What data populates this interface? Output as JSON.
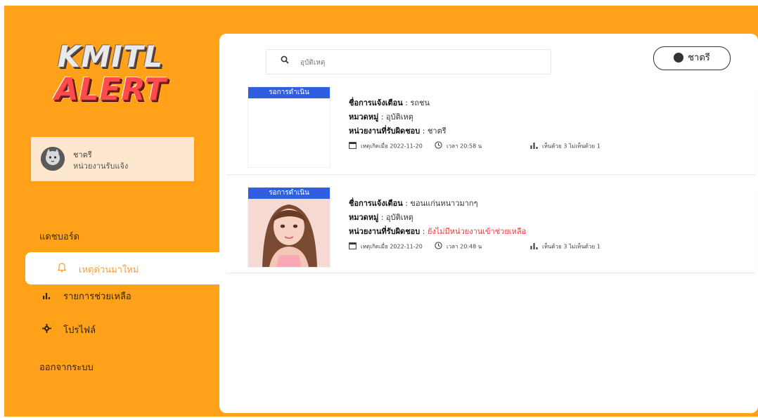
{
  "sidebar": {
    "logo": {
      "line1": "KMITL",
      "line2": "ALERT"
    },
    "user": {
      "name": "ชาตรี",
      "role": "หน่วยงานรับแจ้ง"
    },
    "dashboard_label": "แดชบอร์ด",
    "items": [
      {
        "label": "เหตุด่วนมาใหม่",
        "icon": "bell-icon"
      },
      {
        "label": "รายการช่วยเหลือ",
        "icon": "bar-chart-icon"
      },
      {
        "label": "โปรไฟล์",
        "icon": "gear-icon"
      }
    ],
    "logout_label": "ออกจากระบบ"
  },
  "header": {
    "search_value": "อุบัติเหตุ",
    "profile_label": "ชาตรี"
  },
  "cards": [
    {
      "status": "รอการดำเนิน",
      "title_label": "ชื่อการแจ้งเตือน",
      "title_value": "รถชน",
      "category_label": "หมวดหมู่",
      "category_value": "อุบัติเหตุ",
      "agency_label": "หน่วยงานที่รับผิดชอบ",
      "agency_value": "ชาตรี",
      "date_text": "เหตุเกิดเมื่อ 2022-11-20",
      "time_text": "เวลา 20:58 น",
      "stats_text": "เห็นด้วย 3 ไม่เห็นด้วย 1"
    },
    {
      "status": "รอการดำเนิน",
      "title_label": "ชื่อการแจ้งเตือน",
      "title_value": "ขอนแก่นหนาวมากๆ",
      "category_label": "หมวดหมู่",
      "category_value": "อุบัติเหตุ",
      "agency_label": "หน่วยงานที่รับผิดชอบ",
      "agency_value": "ยังไม่มีหน่วยงานเข้าช่วยเหลือ",
      "date_text": "เหตุเกิดเมื่อ 2022-11-20",
      "time_text": "เวลา 20:48 น",
      "stats_text": "เห็นด้วย 3 ไม่เห็นด้วย 1"
    }
  ],
  "colors": {
    "sidebar_bg": "#ffa21a",
    "accent": "#ff9e2d",
    "status_tag": "#2f5fe0",
    "warning_text": "#ff3333"
  }
}
